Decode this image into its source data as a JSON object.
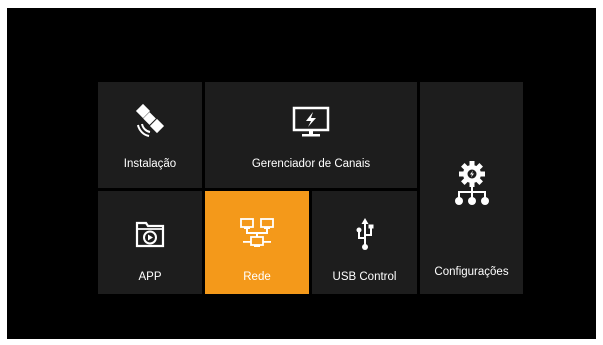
{
  "menu": {
    "selected": "rede",
    "colors": {
      "background": "#000000",
      "tile": "#1d1d1d",
      "selected_tile": "#f4991a",
      "text": "#ffffff"
    },
    "tiles": {
      "instalacao": {
        "label": "Instalação",
        "icon": "satellite-icon"
      },
      "gerenciador": {
        "label": "Gerenciador de Canais",
        "icon": "tv-monitor-icon"
      },
      "configuracoes": {
        "label": "Configurações",
        "icon": "gear-network-icon"
      },
      "app": {
        "label": "APP",
        "icon": "app-folder-play-icon"
      },
      "rede": {
        "label": "Rede",
        "icon": "network-computers-icon"
      },
      "usb": {
        "label": "USB Control",
        "icon": "usb-icon"
      }
    }
  }
}
